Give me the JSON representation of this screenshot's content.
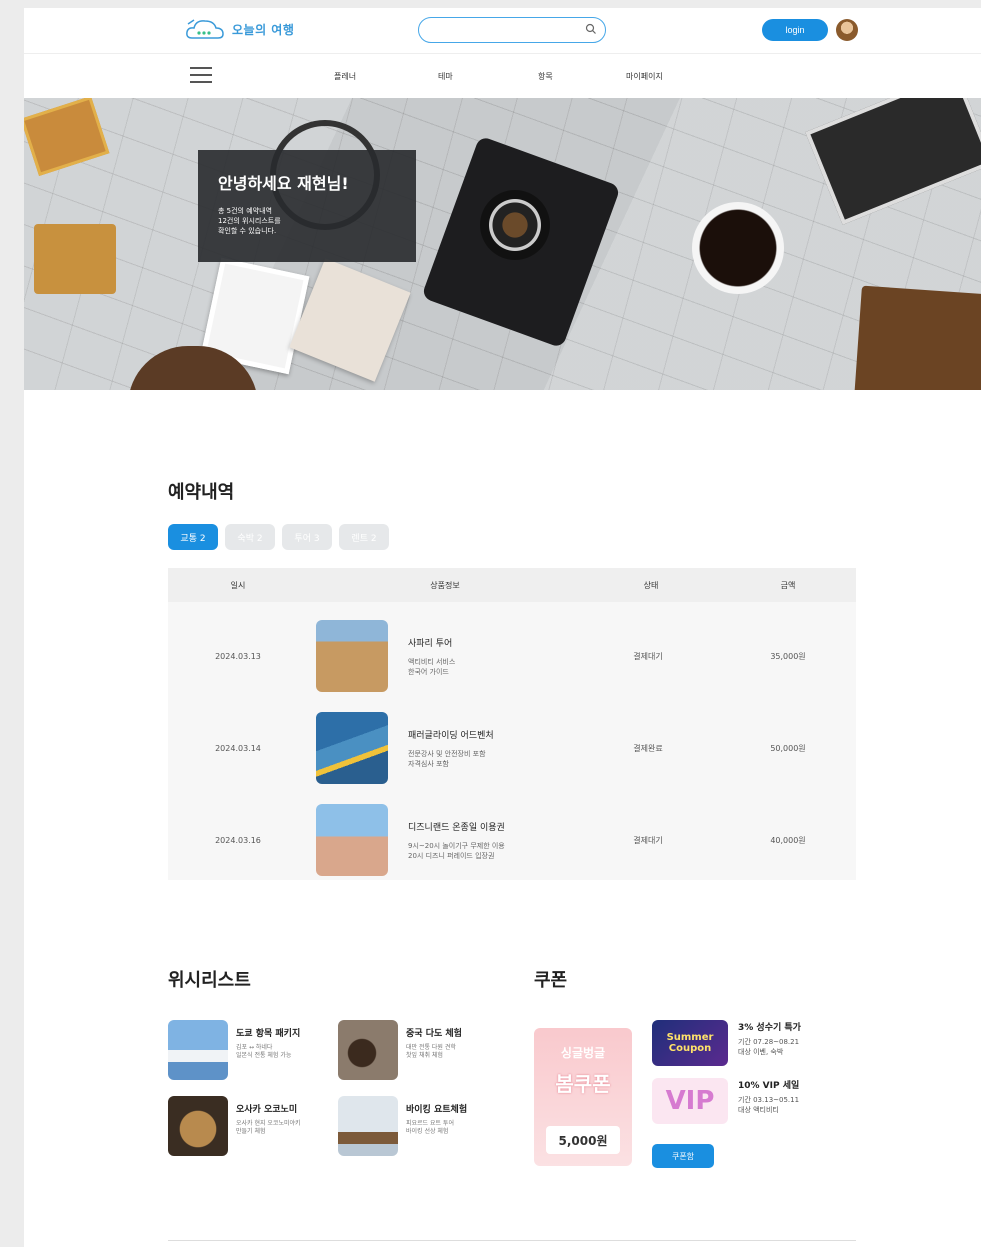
{
  "header": {
    "logo_text": "오늘의 여행",
    "search_placeholder": "",
    "login_label": "login"
  },
  "nav": {
    "items": [
      "플레너",
      "테마",
      "항목",
      "마이페이지"
    ]
  },
  "hero": {
    "title": "안녕하세요 재현님!",
    "subtitle": "총 5건의 예약내역\n12건의 위시리스트를\n확인할 수 있습니다."
  },
  "reservation": {
    "title": "예약내역",
    "tabs": [
      "교통 2",
      "숙박 2",
      "투어 3",
      "렌트 2"
    ],
    "columns": [
      "일시",
      "상품정보",
      "상태",
      "금액"
    ],
    "rows": [
      {
        "date": "2024.03.13",
        "title": "사파리 투어",
        "desc": "액티비티 서비스\n한국어 가이드",
        "status": "결제대기",
        "price": "35,000원"
      },
      {
        "date": "2024.03.14",
        "title": "패러글라이딩 어드벤처",
        "desc": "전문강사 및 안전장비 포함\n자격심사 포함",
        "status": "결제완료",
        "price": "50,000원"
      },
      {
        "date": "2024.03.16",
        "title": "디즈니랜드 온종일 이용권",
        "desc": "9시~20시 놀이기구 무제한 이용\n20시 디즈니 퍼레이드 입장권",
        "status": "결제대기",
        "price": "40,000원"
      }
    ]
  },
  "wishlist": {
    "title": "위시리스트",
    "items": [
      {
        "title": "도쿄 항목 패키지",
        "desc": "김포 ↔ 하네다\n일본식 전통 체험 가능"
      },
      {
        "title": "중국 다도 체험",
        "desc": "대만 전통 다원 견학\n찻잎 채취 체험"
      },
      {
        "title": "오사카 오코노미",
        "desc": "오사카 현지 오코노미야키\n만들기 체험"
      },
      {
        "title": "바이킹 요트체험",
        "desc": "피요르드 요트 투어\n바이킹 선상 체험"
      }
    ]
  },
  "coupon": {
    "title": "쿠폰",
    "card_head": "싱글벙글",
    "card_big": "봄쿠폰",
    "card_amount": "5,000원",
    "items": [
      {
        "thumb": "Summer Coupon",
        "title": "3% 성수기 특가",
        "period": "기간 07.28~08.21",
        "target": "대상 이벤, 숙박"
      },
      {
        "thumb": "VIP",
        "title": "10% VIP 세일",
        "period": "기간 03.13~05.11",
        "target": "대상 액티비티"
      }
    ],
    "button_label": "쿠폰함"
  },
  "colors": {
    "accent": "#1a8fe0",
    "tab_inactive": "#e6e8ea",
    "hero_box": "#2a2c30"
  }
}
